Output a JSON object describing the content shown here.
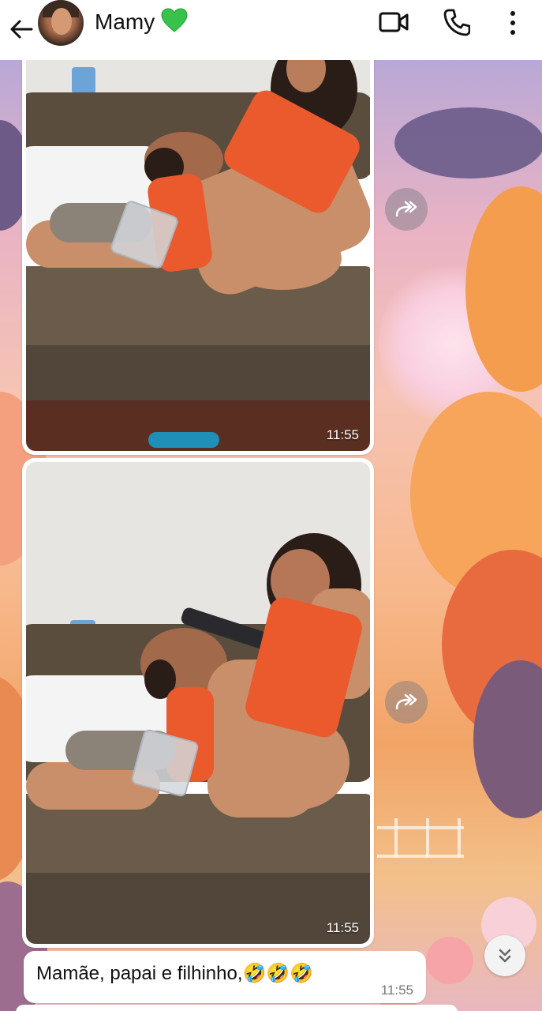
{
  "header": {
    "contact_name": "Mamy",
    "status_emoji": "green-heart",
    "icons": [
      "back-arrow-icon",
      "video-call-icon",
      "phone-call-icon",
      "more-options-icon"
    ]
  },
  "messages": [
    {
      "type": "image",
      "time": "11:55",
      "description_icon": "forward-icon"
    },
    {
      "type": "image",
      "time": "11:55",
      "description_icon": "forward-icon"
    },
    {
      "type": "text",
      "text": "Mamãe, papai e filhinho,🤣🤣🤣",
      "time": "11:55"
    }
  ],
  "colors": {
    "header_bg": "#ffffff",
    "bubble_bg": "#ffffff",
    "heart": "#2ecc40"
  }
}
